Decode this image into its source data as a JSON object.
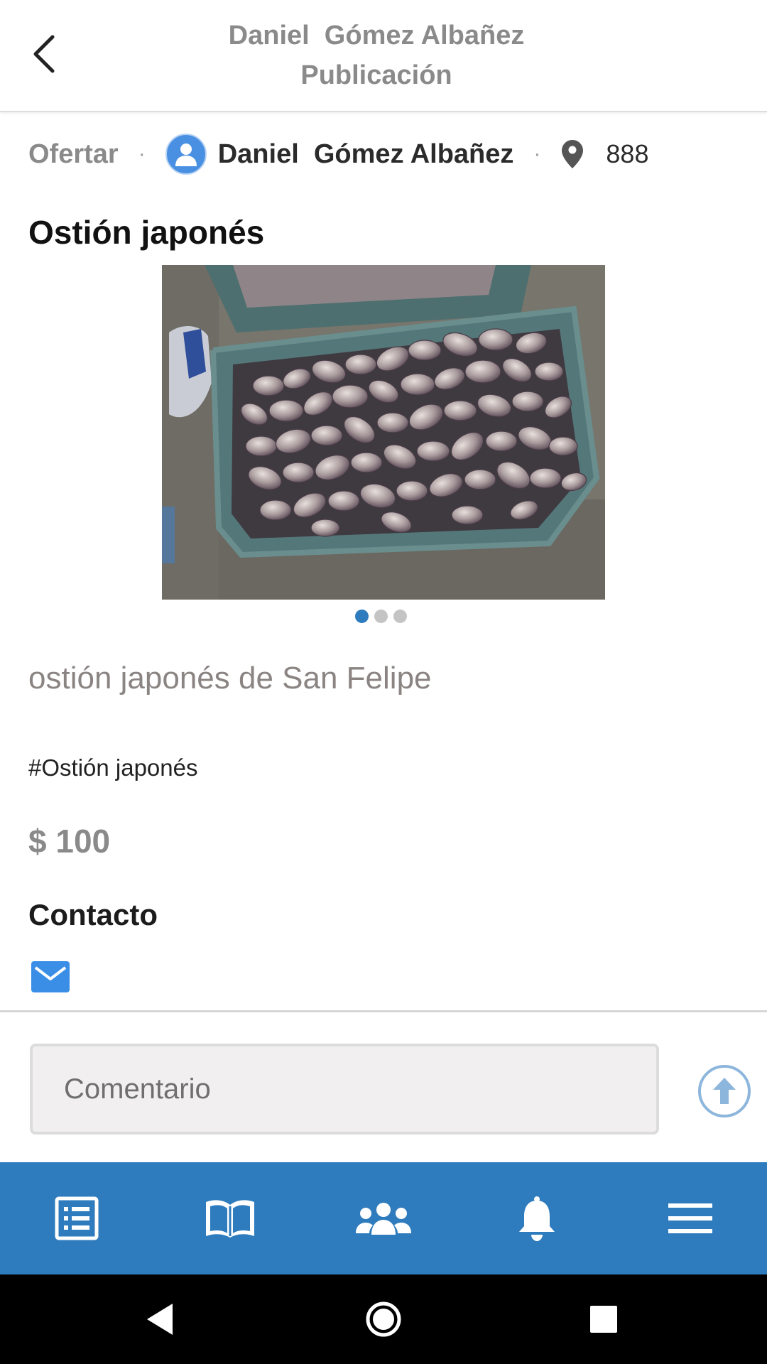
{
  "header": {
    "title_line1": "Daniel  Gómez Albañez",
    "title_line2": "Publicación",
    "back_icon": "chevron-left-icon"
  },
  "post": {
    "type": "Ofertar",
    "author": "Daniel  Gómez Albañez",
    "location": "888",
    "title": "Ostión japonés",
    "image": {
      "subject": "oysters in crates on sand",
      "total_images": 3,
      "current_index": 1
    },
    "description": "ostión japonés de San Felipe",
    "hashtag": "#Ostión japonés",
    "price": "$ 100",
    "contact_heading": "Contacto",
    "contact_icon": "mail-icon"
  },
  "comment": {
    "placeholder": "Comentario",
    "send_icon": "arrow-up-circle-icon"
  },
  "bottom_nav": {
    "items": [
      {
        "icon": "list-icon"
      },
      {
        "icon": "book-icon"
      },
      {
        "icon": "users-icon"
      },
      {
        "icon": "bell-icon"
      },
      {
        "icon": "menu-icon"
      }
    ],
    "color": "#2e7bbd"
  },
  "system_nav": {
    "items": [
      "back",
      "home",
      "recents"
    ]
  },
  "colors": {
    "accent": "#2e7bbd",
    "avatar": "#4a90e2",
    "muted_text": "#8a8a8a",
    "mail": "#3a8ee6"
  }
}
